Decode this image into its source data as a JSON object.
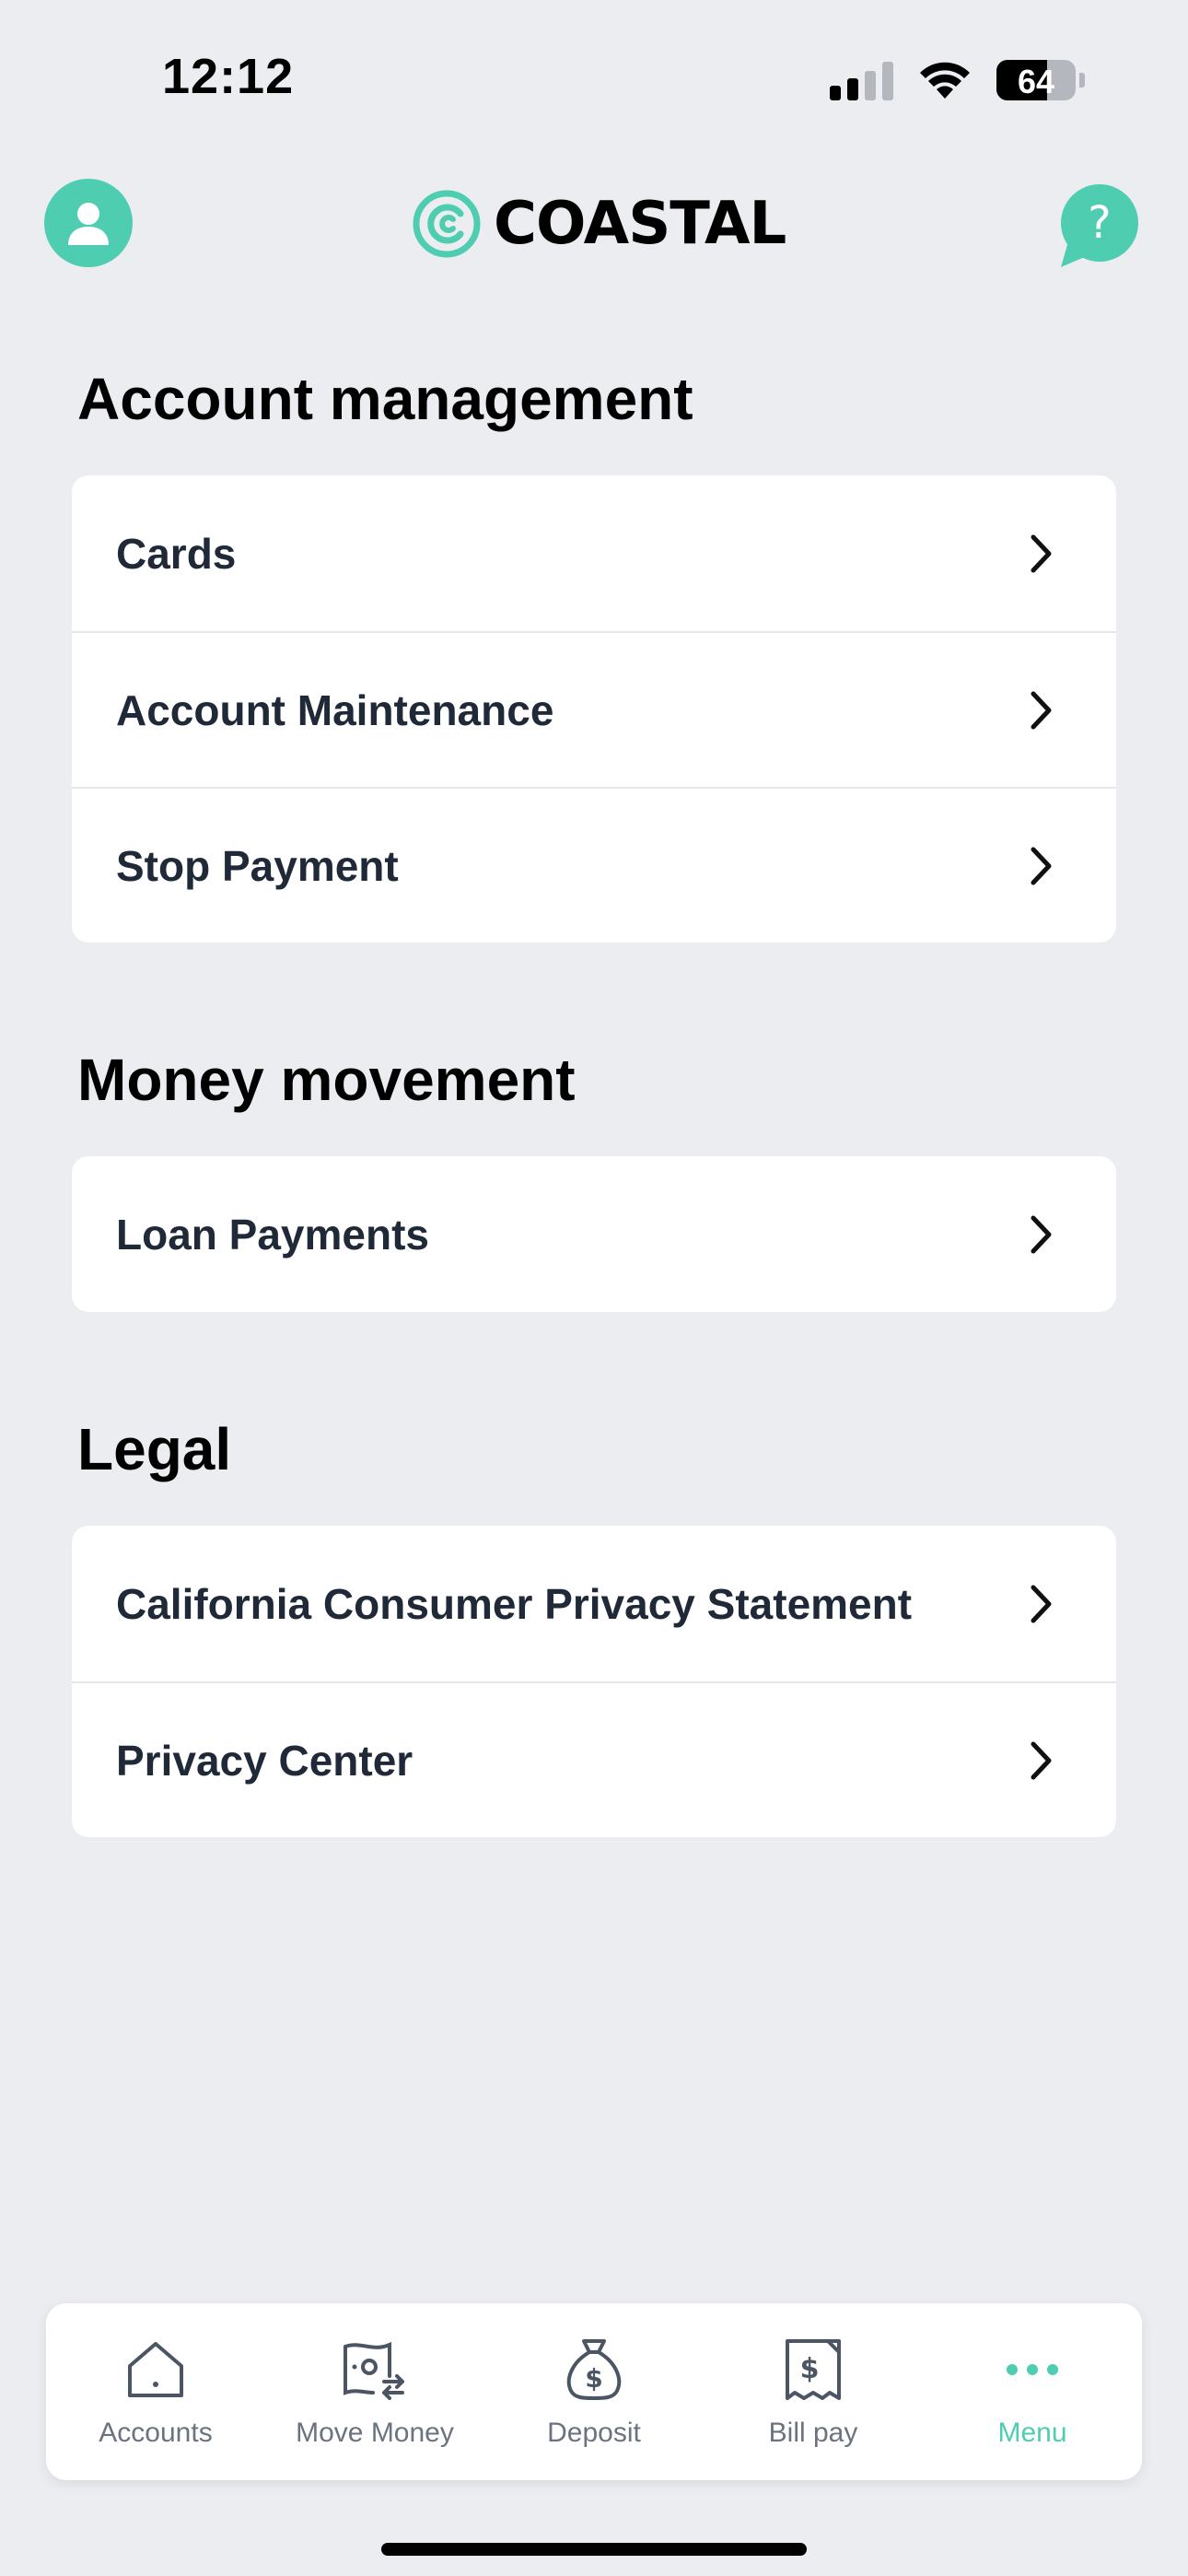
{
  "status_bar": {
    "time": "12:12",
    "battery": "64"
  },
  "header": {
    "brand": "COASTAL"
  },
  "sections": [
    {
      "title": "Account management",
      "items": [
        "Cards",
        "Account Maintenance",
        "Stop Payment"
      ]
    },
    {
      "title": "Money movement",
      "items": [
        "Loan Payments"
      ]
    },
    {
      "title": "Legal",
      "items": [
        "California Consumer Privacy Statement",
        "Privacy Center"
      ]
    }
  ],
  "tabbar": {
    "tabs": [
      {
        "label": "Accounts",
        "icon": "house-icon"
      },
      {
        "label": "Move Money",
        "icon": "money-transfer-icon"
      },
      {
        "label": "Deposit",
        "icon": "money-bag-icon"
      },
      {
        "label": "Bill pay",
        "icon": "receipt-icon"
      },
      {
        "label": "Menu",
        "icon": "more-dots-icon",
        "active": true
      }
    ]
  },
  "colors": {
    "accent": "#4ecdb0",
    "background": "#ebedf1",
    "text": "#1f2937"
  }
}
